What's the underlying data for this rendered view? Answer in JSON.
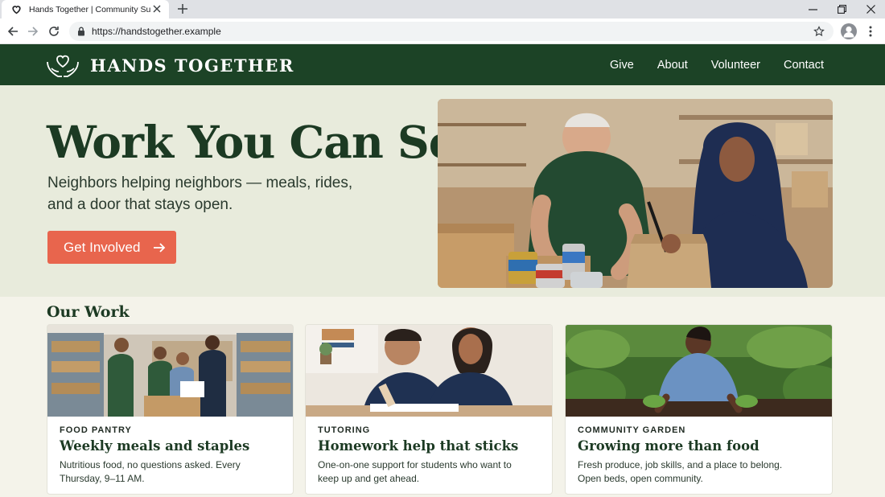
{
  "browser": {
    "tab_title": "Hands Together | Community Support",
    "url": "https://handstogether.example",
    "icons": [
      "heart-favicon-icon",
      "close-icon",
      "plus-icon",
      "minimize-icon",
      "restore-icon",
      "close-window-icon",
      "back-arrow-icon",
      "forward-arrow-icon",
      "reload-icon",
      "lock-icon",
      "star-icon",
      "profile-icon",
      "more-vert-icon"
    ]
  },
  "site": {
    "name": "HANDS TOGETHER",
    "colors": {
      "header": "#1c4326",
      "accent": "#e8654d",
      "hero_bg": "#e8ebdc"
    },
    "nav": [
      {
        "label": "Give"
      },
      {
        "label": "About"
      },
      {
        "label": "Volunteer"
      },
      {
        "label": "Contact"
      }
    ]
  },
  "hero": {
    "title": "Work You Can See",
    "subtitle": "Neighbors helping neighbors — meals, rides, and a door that stays open.",
    "cta_label": "Get Involved"
  },
  "work": {
    "title": "Our Work",
    "cards": [
      {
        "category": "FOOD PANTRY",
        "heading": "Weekly meals and staples",
        "text": "Nutritious food, no questions asked. Every Thursday, 9–11 AM."
      },
      {
        "category": "TUTORING",
        "heading": "Homework help that sticks",
        "text": "One-on-one support for students who want to keep up and get ahead."
      },
      {
        "category": "COMMUNITY GARDEN",
        "heading": "Growing more than food",
        "text": "Fresh produce, job skills, and a place to belong. Open beds, open community."
      }
    ]
  }
}
